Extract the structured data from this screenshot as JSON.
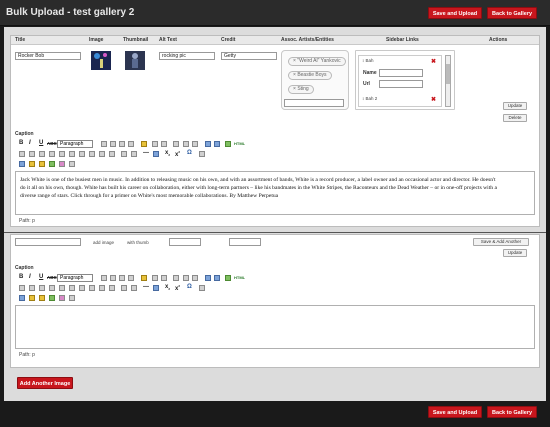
{
  "header": {
    "title": "Bulk Upload - test gallery 2",
    "save_label": "Save and Upload",
    "back_label": "Back to Gallery"
  },
  "table": {
    "columns": [
      "Title",
      "Image",
      "Thumbnail",
      "Alt Text",
      "Credit",
      "Assoc. Artists/Entities",
      "Sidebar Links",
      "Actions"
    ]
  },
  "row1": {
    "title_value": "Rocker Bob",
    "alt_value": "rocking pic",
    "credit_value": "Getty",
    "tags": [
      "\"Weird Al\" Yankovic",
      "Beastie Boys",
      "Sting"
    ],
    "links": {
      "item1": "Bah",
      "item2": "Bah 2",
      "name_label": "Name",
      "url_label": "Url",
      "remove_icon": "x-icon"
    },
    "update_label": "Update",
    "delete_label": "Delete"
  },
  "caption_label": "Caption",
  "toolbar": {
    "bold": "B",
    "italic": "I",
    "underline": "U",
    "strike": "ABC",
    "format_value": "Paragraph",
    "subscript": "x",
    "superscript": "x",
    "omega": "Ω",
    "html": "HTML"
  },
  "caption_text": "Jack White is one of the busiest men in music. In addition to releasing music on his own, and with an assortment of bands, White is a record producer, a label owner and an occasional actor and director. He doesn't do it all on his own, though. White has built his career on collaboration, either with long-term partners – like his bandmates in the White Stripes, the Raconteurs and the Dead Weather – or in one-off projects with a diverse range of stars. Click through for a primer on White's most memorable collaborations. By Matthew Perpetua",
  "path_label": "Path: p",
  "row2": {
    "add_image_label": "add image",
    "with_thumb_label": "with thumb",
    "save_add_label": "Save & Add Another",
    "update_label": "Update"
  },
  "add_another_label": "Add Another Image",
  "colors": {
    "accent": "#c8161d",
    "topbar": "#2b2b2b",
    "content_bg": "#dcdcdc"
  }
}
